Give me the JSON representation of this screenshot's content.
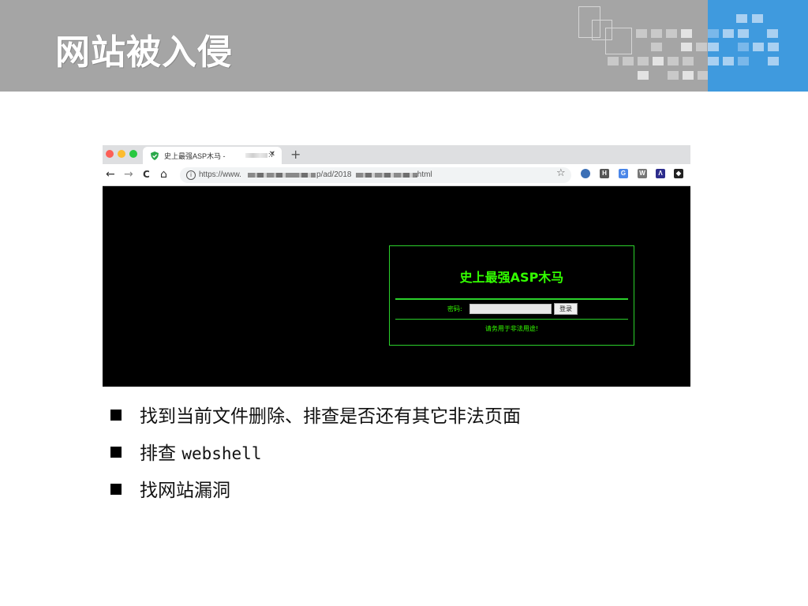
{
  "slide": {
    "title": "网站被入侵",
    "colors": {
      "header_gray": "#a5a5a5",
      "header_blue": "#3f9ade"
    }
  },
  "browser": {
    "tab": {
      "title": "史上最强ASP木马 -",
      "title_suffix": ":7",
      "close": "✕",
      "new_tab": "+"
    },
    "toolbar": {
      "back": "←",
      "forward": "→",
      "reload": "C",
      "home": "⌂",
      "star": "☆"
    },
    "url": {
      "prefix": "https://www.",
      "mid": "p/ad/2018",
      "suffix": ".html",
      "info": "i"
    },
    "extensions": [
      {
        "name": "firefox-sync-icon",
        "glyph": "",
        "color": "#3b6fb6"
      },
      {
        "name": "bookmark-extension-icon",
        "glyph": "H",
        "color": "#555555"
      },
      {
        "name": "translate-icon",
        "glyph": "G",
        "color": "#4a86e8"
      },
      {
        "name": "wikipedia-icon",
        "glyph": "W",
        "color": "#777777"
      },
      {
        "name": "wappalyzer-icon",
        "glyph": "Λ",
        "color": "#2c2c8c"
      },
      {
        "name": "fox-extension-icon",
        "glyph": "◆",
        "color": "#222222"
      }
    ]
  },
  "webshell": {
    "title": "史上最强ASP木马",
    "password_label": "密码:",
    "login_button": "登录",
    "warning": "请务用于非法用途!",
    "colors": {
      "text": "#33ff00",
      "border": "#2bd12b",
      "background": "#000000"
    }
  },
  "bullets": [
    {
      "text": "找到当前文件删除、排查是否还有其它非法页面"
    },
    {
      "text_cn": "排查",
      "text_en": "webshell"
    },
    {
      "text": "找网站漏洞"
    }
  ]
}
